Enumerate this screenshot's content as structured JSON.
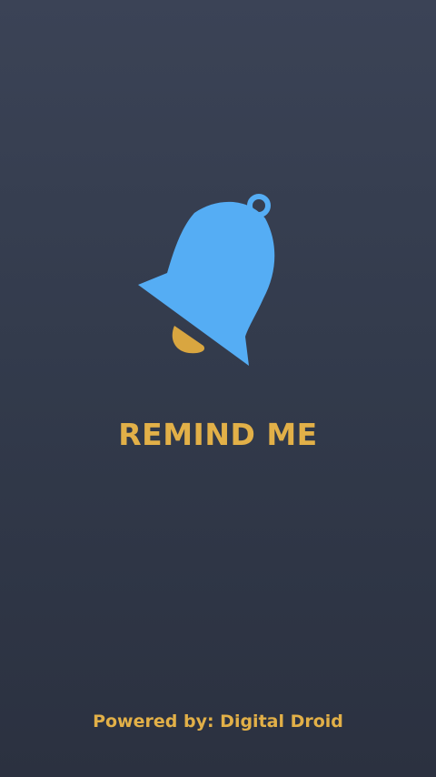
{
  "splash": {
    "app_name": "REMIND ME",
    "powered_by": "Powered by: Digital Droid",
    "logo_icon": "bell-icon"
  },
  "colors": {
    "background_top": "#3b4356",
    "background_bottom": "#2b3140",
    "bell_body": "#55adf4",
    "bell_clapper": "#d9a640",
    "text_accent": "#e2b048"
  }
}
